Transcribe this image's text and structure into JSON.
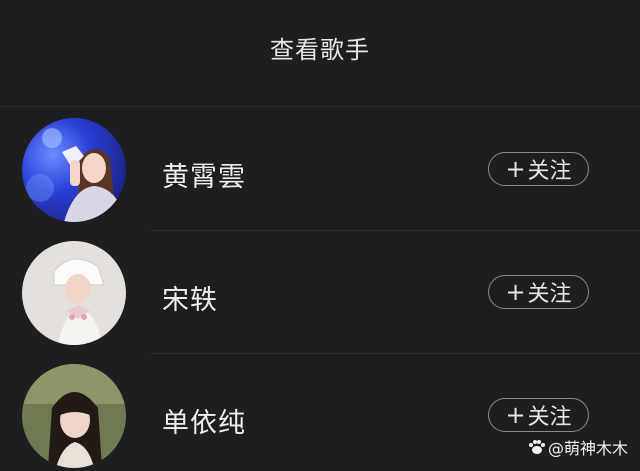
{
  "header": {
    "title": "查看歌手"
  },
  "singers": [
    {
      "name": "黄霄雲",
      "follow_label": "关注",
      "follow_icon": "plus-icon"
    },
    {
      "name": "宋轶",
      "follow_label": "关注",
      "follow_icon": "plus-icon"
    },
    {
      "name": "单依纯",
      "follow_label": "关注",
      "follow_icon": "plus-icon"
    }
  ],
  "watermark": {
    "text": "@萌神木木",
    "icon": "paw-icon"
  },
  "colors": {
    "background": "#1d1e20",
    "text": "#eeeeef",
    "button_border": "#8a8b8f",
    "divider": "#2e2f33"
  }
}
